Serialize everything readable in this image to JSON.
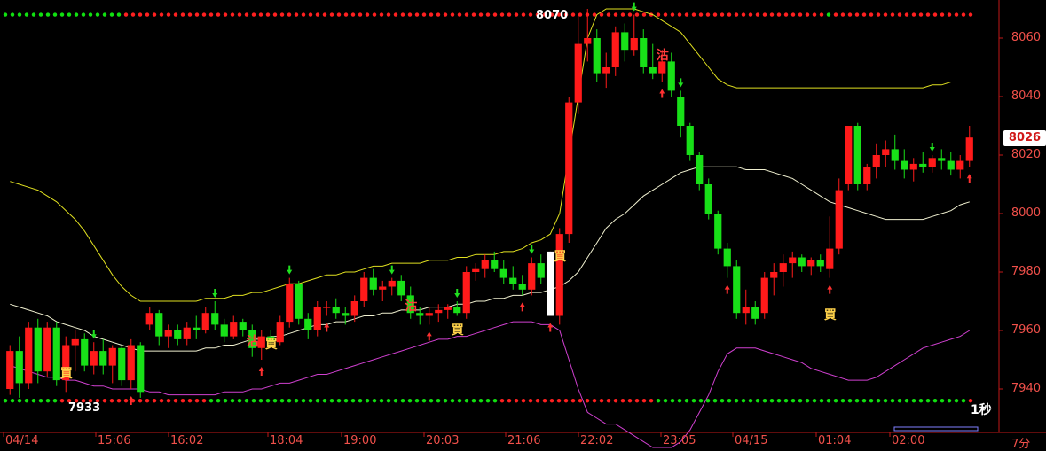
{
  "chart_data": {
    "type": "candlestick",
    "y_range": [
      7930,
      8070
    ],
    "price_ticks": [
      "8060",
      "8040",
      "8020",
      "8000",
      "7980",
      "7960",
      "7940"
    ],
    "time_ticks": [
      "04/14",
      "15:06",
      "16:02",
      "18:04",
      "19:00",
      "20:03",
      "21:06",
      "22:02",
      "23:05",
      "04/15",
      "01:04",
      "02:00"
    ],
    "last_price": "8026",
    "high_marker": "8070",
    "low_marker": "7933",
    "interval_label": "1秒",
    "period_label": "7分",
    "resistance": 8068,
    "support": 7936,
    "candles": [
      [
        7940,
        7955,
        7938,
        7953
      ],
      [
        7953,
        7958,
        7937,
        7942
      ],
      [
        7942,
        7963,
        7940,
        7961
      ],
      [
        7961,
        7964,
        7942,
        7946
      ],
      [
        7946,
        7963,
        7944,
        7961
      ],
      [
        7961,
        7963,
        7941,
        7943
      ],
      [
        7943,
        7958,
        7939,
        7955
      ],
      [
        7955,
        7960,
        7946,
        7957
      ],
      [
        7957,
        7959,
        7946,
        7948
      ],
      [
        7948,
        7956,
        7945,
        7953
      ],
      [
        7953,
        7957,
        7945,
        7948
      ],
      [
        7948,
        7955,
        7942,
        7954
      ],
      [
        7954,
        7955,
        7941,
        7943
      ],
      [
        7943,
        7957,
        7940,
        7955
      ],
      [
        7955,
        7956,
        7937,
        7939
      ],
      [
        7962,
        7968,
        7960,
        7966
      ],
      [
        7966,
        7967,
        7955,
        7958
      ],
      [
        7958,
        7962,
        7954,
        7960
      ],
      [
        7960,
        7962,
        7955,
        7957
      ],
      [
        7957,
        7963,
        7955,
        7961
      ],
      [
        7961,
        7965,
        7957,
        7960
      ],
      [
        7960,
        7968,
        7959,
        7966
      ],
      [
        7966,
        7970,
        7960,
        7962
      ],
      [
        7962,
        7964,
        7956,
        7958
      ],
      [
        7958,
        7965,
        7957,
        7963
      ],
      [
        7963,
        7964,
        7958,
        7960
      ],
      [
        7960,
        7962,
        7951,
        7954
      ],
      [
        7954,
        7960,
        7950,
        7958
      ],
      [
        7958,
        7960,
        7954,
        7956
      ],
      [
        7956,
        7965,
        7955,
        7963
      ],
      [
        7963,
        7978,
        7961,
        7976
      ],
      [
        7976,
        7977,
        7962,
        7964
      ],
      [
        7964,
        7966,
        7957,
        7960
      ],
      [
        7960,
        7970,
        7958,
        7968
      ],
      [
        7968,
        7970,
        7965,
        7968
      ],
      [
        7968,
        7971,
        7964,
        7966
      ],
      [
        7966,
        7968,
        7962,
        7965
      ],
      [
        7965,
        7972,
        7963,
        7970
      ],
      [
        7970,
        7980,
        7968,
        7978
      ],
      [
        7978,
        7981,
        7972,
        7974
      ],
      [
        7974,
        7977,
        7970,
        7975
      ],
      [
        7975,
        7978,
        7972,
        7977
      ],
      [
        7977,
        7979,
        7970,
        7972
      ],
      [
        7972,
        7975,
        7964,
        7966
      ],
      [
        7966,
        7968,
        7962,
        7965
      ],
      [
        7965,
        7968,
        7962,
        7966
      ],
      [
        7966,
        7969,
        7963,
        7967
      ],
      [
        7967,
        7969,
        7964,
        7968
      ],
      [
        7968,
        7970,
        7965,
        7966
      ],
      [
        7966,
        7982,
        7964,
        7980
      ],
      [
        7980,
        7983,
        7977,
        7981
      ],
      [
        7981,
        7986,
        7978,
        7984
      ],
      [
        7984,
        7987,
        7980,
        7981
      ],
      [
        7981,
        7984,
        7976,
        7978
      ],
      [
        7978,
        7982,
        7974,
        7976
      ],
      [
        7976,
        7979,
        7972,
        7974
      ],
      [
        7974,
        7985,
        7972,
        7983
      ],
      [
        7983,
        7986,
        7976,
        7978
      ],
      [
        7987,
        7987,
        7965,
        7965
      ],
      [
        7965,
        7995,
        7962,
        7993
      ],
      [
        7993,
        8040,
        7990,
        8038
      ],
      [
        8038,
        8068,
        8034,
        8058
      ],
      [
        8058,
        8070,
        8052,
        8060
      ],
      [
        8060,
        8063,
        8045,
        8048
      ],
      [
        8048,
        8055,
        8043,
        8050
      ],
      [
        8050,
        8064,
        8047,
        8062
      ],
      [
        8062,
        8065,
        8052,
        8056
      ],
      [
        8056,
        8068,
        8054,
        8060
      ],
      [
        8060,
        8063,
        8048,
        8050
      ],
      [
        8050,
        8058,
        8046,
        8048
      ],
      [
        8048,
        8056,
        8045,
        8052
      ],
      [
        8052,
        8055,
        8040,
        8042
      ],
      [
        8040,
        8042,
        8026,
        8030
      ],
      [
        8030,
        8031,
        8018,
        8020
      ],
      [
        8020,
        8021,
        8008,
        8010
      ],
      [
        8010,
        8012,
        7998,
        8000
      ],
      [
        8000,
        8001,
        7986,
        7988
      ],
      [
        7988,
        7990,
        7978,
        7982
      ],
      [
        7982,
        7984,
        7964,
        7966
      ],
      [
        7966,
        7974,
        7962,
        7968
      ],
      [
        7968,
        7970,
        7962,
        7964
      ],
      [
        7966,
        7980,
        7964,
        7978
      ],
      [
        7978,
        7983,
        7972,
        7980
      ],
      [
        7980,
        7986,
        7975,
        7983
      ],
      [
        7983,
        7987,
        7978,
        7985
      ],
      [
        7985,
        7986,
        7980,
        7982
      ],
      [
        7982,
        7985,
        7979,
        7984
      ],
      [
        7984,
        7986,
        7980,
        7982
      ],
      [
        7981,
        7999,
        7978,
        7988
      ],
      [
        7988,
        8012,
        7986,
        8008
      ],
      [
        8010,
        8030,
        8008,
        8030
      ],
      [
        8030,
        8031,
        8008,
        8010
      ],
      [
        8010,
        8017,
        8008,
        8016
      ],
      [
        8016,
        8024,
        8012,
        8020
      ],
      [
        8020,
        8025,
        8016,
        8022
      ],
      [
        8022,
        8027,
        8015,
        8018
      ],
      [
        8018,
        8022,
        8012,
        8015
      ],
      [
        8015,
        8019,
        8011,
        8017
      ],
      [
        8017,
        8021,
        8014,
        8016
      ],
      [
        8016,
        8020,
        8014,
        8019
      ],
      [
        8019,
        8022,
        8015,
        8018
      ],
      [
        8018,
        8021,
        8013,
        8015
      ],
      [
        8015,
        8020,
        8012,
        8018
      ],
      [
        8018,
        8030,
        8016,
        8026
      ]
    ],
    "bands": {
      "upper": [
        8011,
        8010,
        8009,
        8008,
        8006,
        8004,
        8001,
        7998,
        7994,
        7989,
        7984,
        7979,
        7975,
        7972,
        7970,
        7970,
        7970,
        7970,
        7970,
        7970,
        7970,
        7971,
        7971,
        7971,
        7972,
        7972,
        7973,
        7973,
        7974,
        7975,
        7976,
        7976,
        7977,
        7978,
        7979,
        7979,
        7980,
        7980,
        7981,
        7982,
        7982,
        7983,
        7983,
        7983,
        7983,
        7984,
        7984,
        7984,
        7985,
        7985,
        7986,
        7986,
        7986,
        7987,
        7987,
        7988,
        7990,
        7991,
        7993,
        8000,
        8020,
        8040,
        8060,
        8068,
        8070,
        8070,
        8070,
        8070,
        8069,
        8068,
        8066,
        8064,
        8062,
        8058,
        8054,
        8050,
        8046,
        8044,
        8043,
        8043,
        8043,
        8043,
        8043,
        8043,
        8043,
        8043,
        8043,
        8043,
        8043,
        8043,
        8043,
        8043,
        8043,
        8043,
        8043,
        8043,
        8043,
        8043,
        8043,
        8044,
        8044,
        8045,
        8045,
        8045
      ],
      "middle": [
        7969,
        7968,
        7967,
        7966,
        7965,
        7963,
        7962,
        7961,
        7960,
        7958,
        7957,
        7956,
        7955,
        7954,
        7953,
        7953,
        7953,
        7953,
        7953,
        7953,
        7953,
        7954,
        7954,
        7955,
        7955,
        7956,
        7957,
        7957,
        7958,
        7958,
        7959,
        7960,
        7961,
        7962,
        7962,
        7963,
        7963,
        7964,
        7965,
        7965,
        7966,
        7966,
        7967,
        7967,
        7967,
        7968,
        7968,
        7968,
        7969,
        7969,
        7970,
        7970,
        7971,
        7971,
        7972,
        7972,
        7973,
        7973,
        7974,
        7975,
        7977,
        7980,
        7985,
        7990,
        7995,
        7998,
        8000,
        8003,
        8006,
        8008,
        8010,
        8012,
        8014,
        8015,
        8016,
        8016,
        8016,
        8016,
        8016,
        8015,
        8015,
        8015,
        8014,
        8013,
        8012,
        8010,
        8008,
        8006,
        8004,
        8003,
        8002,
        8001,
        8000,
        7999,
        7998,
        7998,
        7998,
        7998,
        7998,
        7999,
        8000,
        8001,
        8003,
        8004
      ],
      "lower": [
        7948,
        7947,
        7946,
        7945,
        7944,
        7944,
        7943,
        7943,
        7942,
        7941,
        7941,
        7940,
        7940,
        7940,
        7940,
        7939,
        7939,
        7938,
        7938,
        7938,
        7938,
        7938,
        7938,
        7939,
        7939,
        7939,
        7940,
        7940,
        7941,
        7942,
        7942,
        7943,
        7944,
        7945,
        7945,
        7946,
        7947,
        7948,
        7949,
        7950,
        7951,
        7952,
        7953,
        7954,
        7955,
        7956,
        7957,
        7957,
        7958,
        7958,
        7959,
        7960,
        7961,
        7962,
        7963,
        7963,
        7963,
        7962,
        7962,
        7960,
        7950,
        7940,
        7932,
        7930,
        7928,
        7928,
        7926,
        7924,
        7922,
        7920,
        7920,
        7920,
        7922,
        7926,
        7932,
        7938,
        7946,
        7952,
        7954,
        7954,
        7954,
        7953,
        7952,
        7951,
        7950,
        7949,
        7947,
        7946,
        7945,
        7944,
        7943,
        7943,
        7943,
        7944,
        7946,
        7948,
        7950,
        7952,
        7954,
        7955,
        7956,
        7957,
        7958,
        7960
      ]
    },
    "signals": [
      {
        "label": "買",
        "kind": "buy",
        "index": 5,
        "price": 7946
      },
      {
        "label": "沽",
        "kind": "short",
        "index": 25,
        "price": 7957
      },
      {
        "label": "買",
        "kind": "buy",
        "index": 27,
        "price": 7956
      },
      {
        "label": "沽",
        "kind": "short",
        "index": 42,
        "price": 7969
      },
      {
        "label": "買",
        "kind": "buy",
        "index": 47,
        "price": 7961
      },
      {
        "label": "買",
        "kind": "buy",
        "index": 58,
        "price": 7986
      },
      {
        "label": "沽",
        "kind": "short",
        "index": 69,
        "price": 8055
      },
      {
        "label": "買",
        "kind": "buy",
        "index": 87,
        "price": 7966
      }
    ],
    "up_arrows": [
      13,
      27,
      34,
      45,
      55,
      58,
      70,
      77,
      88,
      103
    ],
    "down_arrows": [
      9,
      22,
      30,
      41,
      48,
      56,
      67,
      72,
      99
    ],
    "colors": {
      "bull": "#ff1a1a",
      "bear": "#18e018",
      "upper": "#e0e020",
      "middle": "#f0f0d0",
      "lower": "#d040d0",
      "axis": "#c01818",
      "dot_red": "#ff2020",
      "dot_green": "#10e010"
    }
  }
}
